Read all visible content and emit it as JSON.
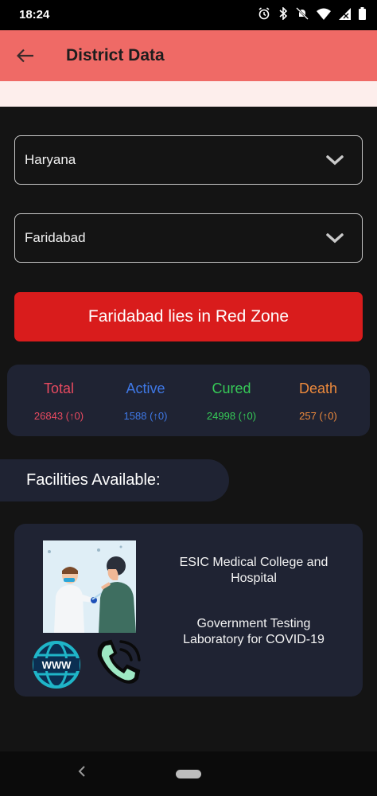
{
  "status_bar": {
    "time": "18:24",
    "icons": [
      "alarm-icon",
      "bluetooth-icon",
      "dnd-off-icon",
      "wifi-icon",
      "signal-icon",
      "battery-icon"
    ]
  },
  "app_bar": {
    "title": "District Data",
    "back_icon": "arrow-left-icon",
    "background": "#ef6a66"
  },
  "state_select": {
    "value": "Haryana"
  },
  "district_select": {
    "value": "Faridabad"
  },
  "zone_banner": {
    "text": "Faridabad lies in Red Zone",
    "color": "#d91c1c"
  },
  "stats": [
    {
      "label": "Total",
      "value": "26843 (↑0)",
      "color": "#e84a60"
    },
    {
      "label": "Active",
      "value": "1588 (↑0)",
      "color": "#3f78e6"
    },
    {
      "label": "Cured",
      "value": "24998 (↑0)",
      "color": "#36c957"
    },
    {
      "label": "Death",
      "value": "257 (↑0)",
      "color": "#ee8a3c"
    }
  ],
  "facilities": {
    "header": "Facilities Available:",
    "items": [
      {
        "name": "ESIC Medical College and Hospital",
        "type": "Government Testing Laboratory for COVID-19",
        "image": "covid-testing-illustration",
        "website_icon": "www-globe-icon",
        "phone_icon": "phone-call-icon"
      }
    ]
  }
}
